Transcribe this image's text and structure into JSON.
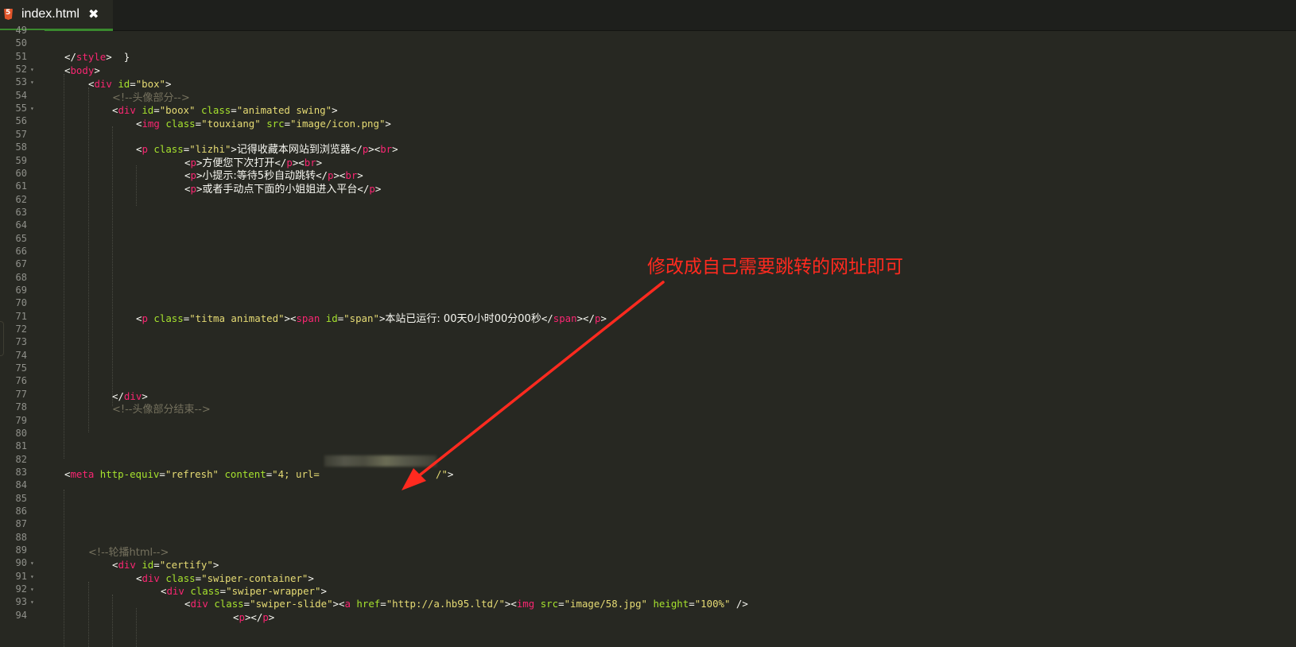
{
  "tab": {
    "file_icon_glyph": "5",
    "title": "index.html",
    "close_glyph": "✖"
  },
  "colors": {
    "background": "#272822",
    "tag": "#f92672",
    "attribute": "#a6e22e",
    "string": "#e6db74",
    "comment": "#75715e",
    "text": "#f8f8f2",
    "line_number": "#8f908a",
    "annotation": "#ff2a1f",
    "active_tab_underline": "#3a8a2e"
  },
  "gutter": {
    "line_numbers": [
      "49",
      "50",
      "51",
      "52",
      "53",
      "54",
      "55",
      "56",
      "57",
      "58",
      "59",
      "60",
      "61",
      "62",
      "63",
      "64",
      "65",
      "66",
      "67",
      "68",
      "69",
      "70",
      "71",
      "72",
      "73",
      "74",
      "75",
      "76",
      "77",
      "78",
      "79",
      "80",
      "81",
      "82",
      "83",
      "84",
      "85",
      "86",
      "87",
      "88",
      "89",
      "90",
      "91",
      "92",
      "93",
      "94"
    ],
    "fold_markers": [
      "52",
      "53",
      "55",
      "90",
      "91",
      "92",
      "93"
    ]
  },
  "code": {
    "line50": "}",
    "line51": [
      "</",
      "style",
      ">"
    ],
    "line52": [
      "<",
      "body",
      ">"
    ],
    "line53": [
      "<",
      "div",
      " ",
      "id",
      "=",
      "\"box\"",
      ">"
    ],
    "line54": "<!--头像部分-->",
    "line55": [
      "<",
      "div",
      " ",
      "id",
      "=",
      "\"boox\"",
      " ",
      "class",
      "=",
      "\"animated swing\"",
      ">"
    ],
    "line56": [
      "<",
      "img",
      " ",
      "class",
      "=",
      "\"touxiang\"",
      " ",
      "src",
      "=",
      "\"image/icon.png\"",
      ">"
    ],
    "line58": [
      "<",
      "p",
      " ",
      "class",
      "=",
      "\"lizhi\"",
      ">",
      "记得收藏本网站到浏览器",
      "</",
      "p",
      "><",
      "br",
      ">"
    ],
    "line59": [
      "<",
      "p",
      ">",
      "方便您下次打开",
      "</",
      "p",
      "><",
      "br",
      ">"
    ],
    "line60": [
      "<",
      "p",
      ">",
      "小提示:等待5秒自动跳转",
      "</",
      "p",
      "><",
      "br",
      ">"
    ],
    "line61": [
      "<",
      "p",
      ">",
      "或者手动点下面的小姐姐进入平台",
      "</",
      "p",
      ">"
    ],
    "line71": [
      "<",
      "p",
      " ",
      "class",
      "=",
      "\"titma animated\"",
      "><",
      "span",
      " ",
      "id",
      "=",
      "\"span\"",
      ">",
      "本站已运行: 00天0小时00分00秒",
      "</",
      "span",
      "></",
      "p",
      ">"
    ],
    "line77": [
      "</",
      "div",
      ">"
    ],
    "line78": "<!--头像部分结束-->",
    "line83": [
      "<",
      "meta",
      " ",
      "http-equiv",
      "=",
      "\"refresh\"",
      " ",
      "content",
      "=",
      "\"4; url=",
      "/\"",
      ">"
    ],
    "line89": "<!--轮播html-->",
    "line90": [
      "<",
      "div",
      " ",
      "id",
      "=",
      "\"certify\"",
      ">"
    ],
    "line91": [
      "<",
      "div",
      " ",
      "class",
      "=",
      "\"swiper-container\"",
      ">"
    ],
    "line92": [
      "<",
      "div",
      " ",
      "class",
      "=",
      "\"swiper-wrapper\"",
      ">"
    ],
    "line93": [
      "<",
      "div",
      " ",
      "class",
      "=",
      "\"swiper-slide\"",
      "><",
      "a",
      " ",
      "href",
      "=",
      "\"http://a.hb95.ltd/\"",
      "><",
      "img",
      " ",
      "src",
      "=",
      "\"image/58.jpg\"",
      " ",
      "height",
      "=",
      "\"100%\"",
      " />"
    ],
    "line94": [
      "<",
      "p",
      "></",
      "p",
      ">"
    ]
  },
  "annotation": {
    "text": "修改成自己需要跳转的网址即可"
  }
}
